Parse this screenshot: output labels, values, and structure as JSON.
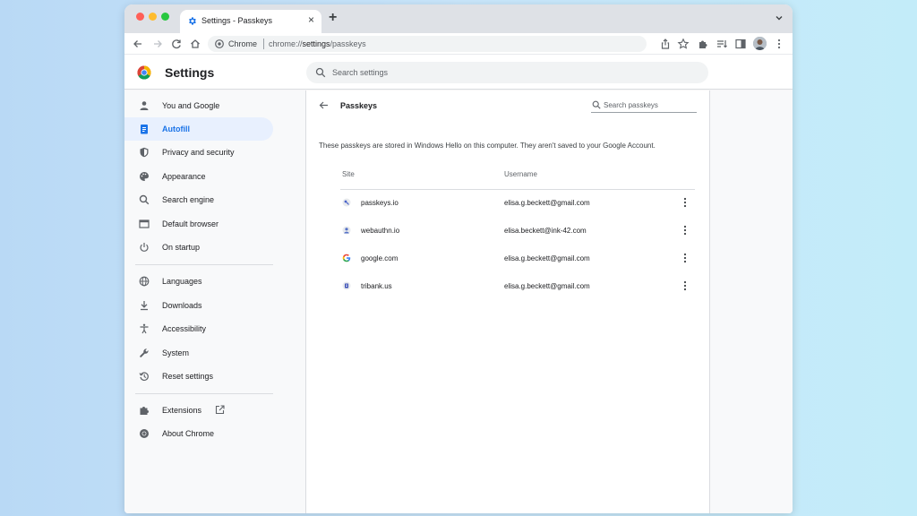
{
  "browser": {
    "tab_title": "Settings - Passkeys",
    "tab_close": "×",
    "new_tab": "+",
    "omnibox_site": "Chrome",
    "url_prefix": "chrome://",
    "url_bold": "settings",
    "url_suffix": "/passkeys"
  },
  "header": {
    "title": "Settings",
    "search_placeholder": "Search settings"
  },
  "sidebar": {
    "items": [
      {
        "label": "You and Google",
        "icon": "person-icon"
      },
      {
        "label": "Autofill",
        "icon": "clipboard-icon",
        "active": true
      },
      {
        "label": "Privacy and security",
        "icon": "shield-icon"
      },
      {
        "label": "Appearance",
        "icon": "palette-icon"
      },
      {
        "label": "Search engine",
        "icon": "search-icon"
      },
      {
        "label": "Default browser",
        "icon": "browser-icon"
      },
      {
        "label": "On startup",
        "icon": "power-icon"
      },
      {
        "label": "Languages",
        "icon": "globe-icon"
      },
      {
        "label": "Downloads",
        "icon": "download-icon"
      },
      {
        "label": "Accessibility",
        "icon": "accessibility-icon"
      },
      {
        "label": "System",
        "icon": "wrench-icon"
      },
      {
        "label": "Reset settings",
        "icon": "history-icon"
      },
      {
        "label": "Extensions",
        "icon": "puzzle-icon"
      },
      {
        "label": "About Chrome",
        "icon": "chrome-icon"
      }
    ]
  },
  "passkeys": {
    "title": "Passkeys",
    "search_placeholder": "Search passkeys",
    "description": "These passkeys are stored in Windows Hello on this computer. They aren't saved to your Google Account.",
    "columns": {
      "site": "Site",
      "username": "Username"
    },
    "rows": [
      {
        "site": "passkeys.io",
        "username": "elisa.g.beckett@gmail.com"
      },
      {
        "site": "webauthn.io",
        "username": "elisa.beckett@ink-42.com"
      },
      {
        "site": "google.com",
        "username": "elisa.g.beckett@gmail.com"
      },
      {
        "site": "tribank.us",
        "username": "elisa.g.beckett@gmail.com"
      }
    ]
  },
  "colors": {
    "accent": "#1a73e8",
    "active_nav_bg": "#e8f0fe",
    "desktop_bg": "#c3e3f8"
  }
}
